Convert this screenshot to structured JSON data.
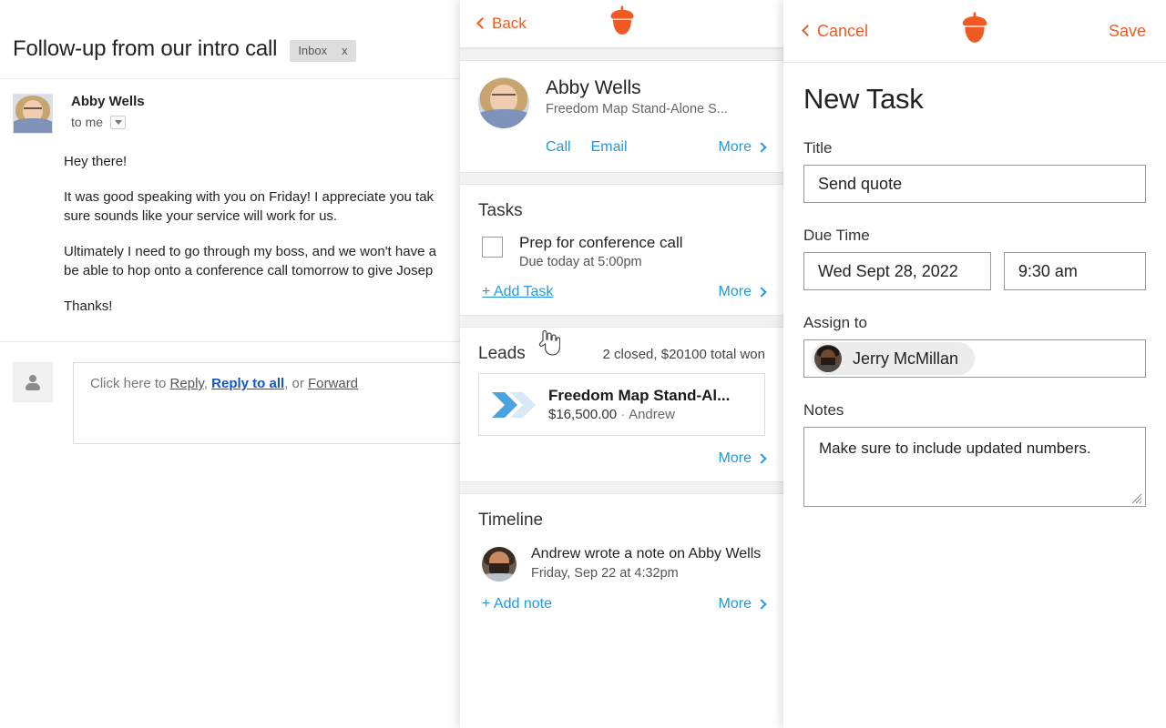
{
  "mail": {
    "subject": "Follow-up from our intro call",
    "label": "Inbox",
    "label_close": "x",
    "sender": "Abby Wells",
    "recipient": "to me",
    "body": [
      "Hey there!",
      "It was good speaking with you on Friday! I appreciate you tak",
      "sure sounds like your service will work for us.",
      "Ultimately I need to go through my boss, and we won't have a",
      "be able to hop onto a conference call tomorrow to give Josep",
      "Thanks!"
    ],
    "reply": {
      "prefix": "Click here to ",
      "reply": "Reply",
      "comma": ", ",
      "reply_all": "Reply to all",
      "or": ", or ",
      "forward": "Forward"
    }
  },
  "crm": {
    "header": {
      "back": "Back",
      "logo": "acorn-logo"
    },
    "contact": {
      "name": "Abby Wells",
      "company": "Freedom Map Stand-Alone S...",
      "call": "Call",
      "email": "Email",
      "more": "More"
    },
    "tasks": {
      "title": "Tasks",
      "items": [
        {
          "title": "Prep for conference call",
          "due": "Due today at 5:00pm",
          "checked": false
        }
      ],
      "add": "+ Add Task",
      "more": "More"
    },
    "leads": {
      "title": "Leads",
      "summary": "2 closed, $20100 total won",
      "items": [
        {
          "name": "Freedom Map Stand-Al...",
          "value": "$16,500.00",
          "separator": "·",
          "owner": "Andrew"
        }
      ],
      "more": "More"
    },
    "timeline": {
      "title": "Timeline",
      "items": [
        {
          "text": "Andrew wrote a note on Abby Wells",
          "date": "Friday, Sep 22 at 4:32pm"
        }
      ],
      "add": "+ Add note",
      "more": "More"
    }
  },
  "new_task": {
    "header": {
      "cancel": "Cancel",
      "save": "Save",
      "logo": "acorn-logo"
    },
    "title": "New Task",
    "fields": {
      "title_label": "Title",
      "title_value": "Send quote",
      "due_label": "Due Time",
      "due_date": "Wed Sept 28, 2022",
      "due_time": "9:30 am",
      "assign_label": "Assign to",
      "assign_value": "Jerry McMillan",
      "notes_label": "Notes",
      "notes_value": "Make sure to include updated numbers."
    }
  },
  "colors": {
    "brand_orange": "#f05a22",
    "link_blue": "#1f9ae0",
    "mail_link_blue": "#1155cc",
    "lead_chevron": "#4aa3dc",
    "lead_chevron_light": "#d7e9f7"
  }
}
